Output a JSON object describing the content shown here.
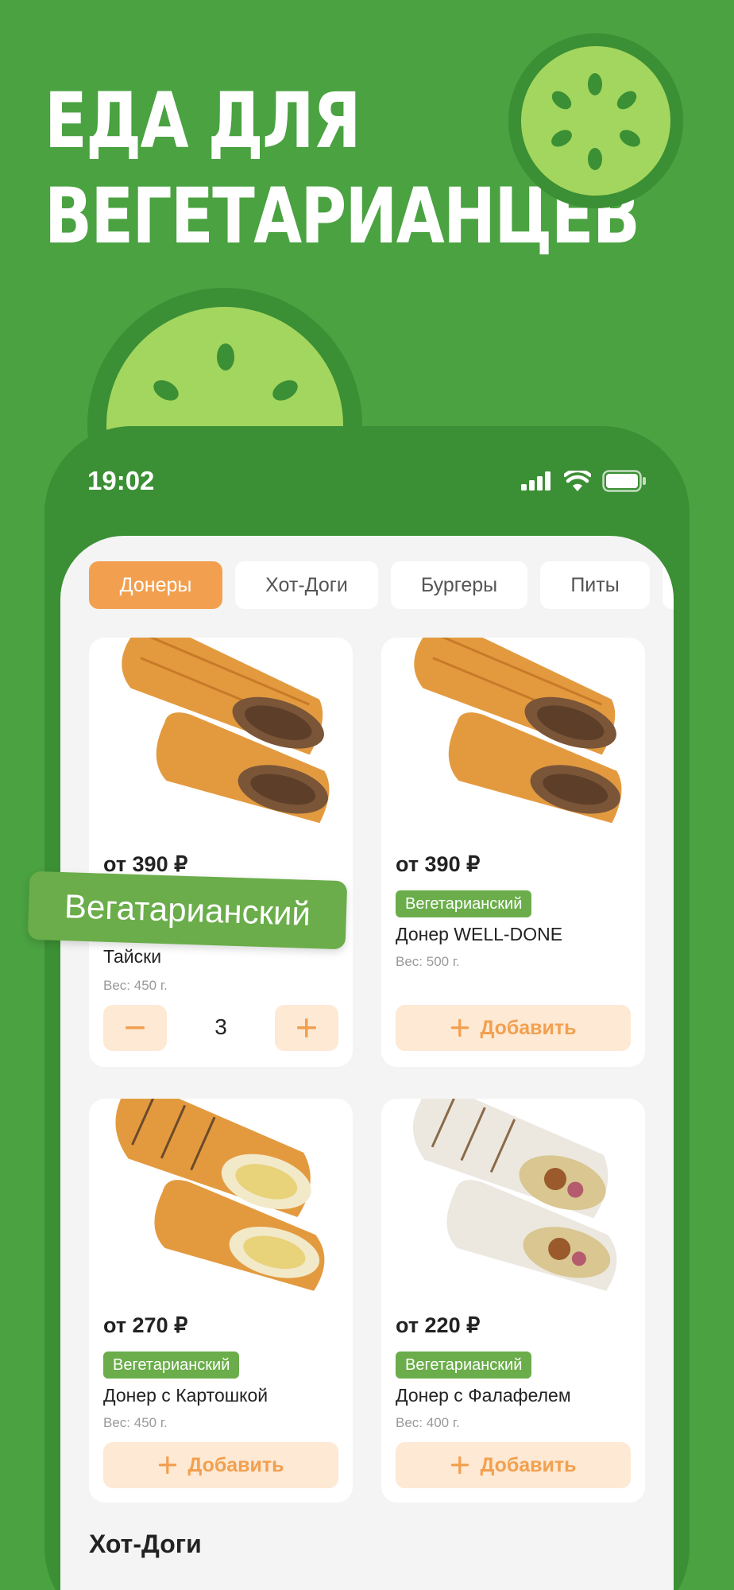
{
  "promo": {
    "line1": "ЕДА ДЛЯ",
    "line2": "ВЕГЕТАРИАНЦЕВ"
  },
  "status_bar": {
    "time": "19:02"
  },
  "tabs": [
    {
      "label": "Донеры",
      "active": true
    },
    {
      "label": "Хот-Доги",
      "active": false
    },
    {
      "label": "Бургеры",
      "active": false
    },
    {
      "label": "Питы",
      "active": false
    }
  ],
  "products": [
    {
      "price": "от 390 ₽",
      "tag": "Вегетарианский",
      "name": "Тайски",
      "weight": "Вес: 450 г.",
      "quantity": "3"
    },
    {
      "price": "от 390 ₽",
      "tag": "Вегетарианский",
      "name": "Донер WELL-DONE",
      "weight": "Вес: 500 г.",
      "button": "Добавить"
    },
    {
      "price": "от 270 ₽",
      "tag": "Вегетарианский",
      "name": "Донер с Картошкой",
      "weight": "Вес: 450 г.",
      "button": "Добавить"
    },
    {
      "price": "от 220 ₽",
      "tag": "Вегетарианский",
      "name": "Донер с Фалафелем",
      "weight": "Вес: 400 г.",
      "button": "Добавить"
    }
  ],
  "floating_badge": "Вегатарианский",
  "section_title": "Хот-Доги",
  "colors": {
    "background": "#4aa241",
    "accent": "#f2a050",
    "tag": "#6aad4a",
    "accent_light": "#fde9d4"
  }
}
